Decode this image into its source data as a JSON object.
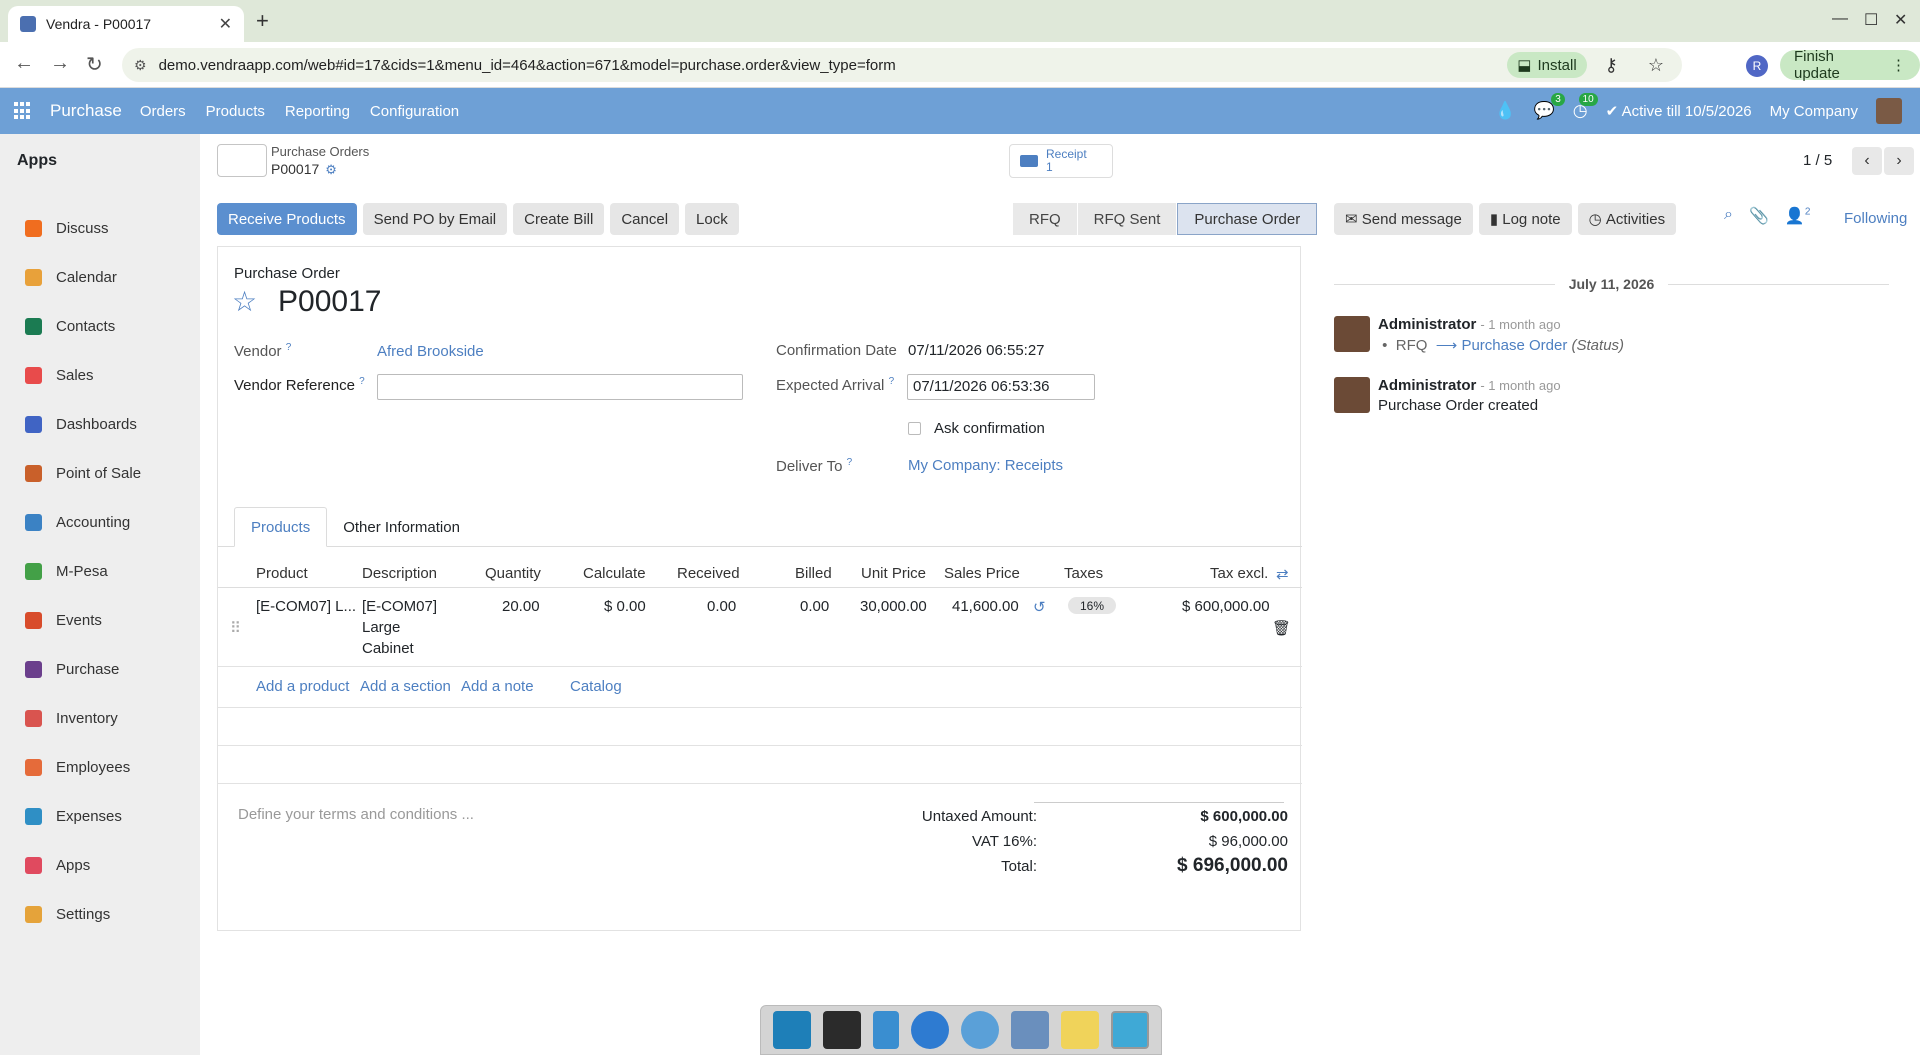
{
  "browser": {
    "tab_title": "Vendra - P00017",
    "url": "demo.vendraapp.com/web#id=17&cids=1&menu_id=464&action=671&model=purchase.order&view_type=form",
    "install_label": "Install",
    "profile_initial": "R",
    "finish_update_label": "Finish update"
  },
  "navbar": {
    "brand": "Purchase",
    "menus": [
      "Orders",
      "Products",
      "Reporting",
      "Configuration"
    ],
    "chat_badge": "3",
    "activity_badge": "10",
    "active_till": "Active till 10/5/2026",
    "company": "My Company"
  },
  "sidebar": {
    "title": "Apps",
    "items": [
      {
        "label": "Discuss",
        "color": "#f06d1f"
      },
      {
        "label": "Calendar",
        "color": "#e8a13a"
      },
      {
        "label": "Contacts",
        "color": "#1b7b52"
      },
      {
        "label": "Sales",
        "color": "#e84b4b"
      },
      {
        "label": "Dashboards",
        "color": "#4064c4"
      },
      {
        "label": "Point of Sale",
        "color": "#c9602a"
      },
      {
        "label": "Accounting",
        "color": "#3b82c4"
      },
      {
        "label": "M-Pesa",
        "color": "#43a047"
      },
      {
        "label": "Events",
        "color": "#d84c2b"
      },
      {
        "label": "Purchase",
        "color": "#6b3f8c"
      },
      {
        "label": "Inventory",
        "color": "#d9544f"
      },
      {
        "label": "Employees",
        "color": "#e56b3a"
      },
      {
        "label": "Expenses",
        "color": "#2f8fc5"
      },
      {
        "label": "Apps",
        "color": "#e04a5f"
      },
      {
        "label": "Settings",
        "color": "#e5a33a"
      }
    ]
  },
  "header": {
    "breadcrumb_parent": "Purchase Orders",
    "breadcrumb_current": "P00017",
    "receipt_label": "Receipt",
    "receipt_count": "1",
    "pager": "1 / 5"
  },
  "actions": {
    "receive": "Receive Products",
    "send_po": "Send PO by Email",
    "create_bill": "Create Bill",
    "cancel": "Cancel",
    "lock": "Lock"
  },
  "status": {
    "stages": [
      "RFQ",
      "RFQ Sent",
      "Purchase Order"
    ],
    "active_index": 2
  },
  "form": {
    "label": "Purchase Order",
    "name": "P00017",
    "vendor_label": "Vendor",
    "vendor": "Afred Brookside",
    "vendor_ref_label": "Vendor Reference",
    "vendor_ref": "",
    "confirmation_label": "Confirmation Date",
    "confirmation": "07/11/2026 06:55:27",
    "expected_label": "Expected Arrival",
    "expected": "07/11/2026 06:53:36",
    "ask_confirmation": "Ask confirmation",
    "deliver_label": "Deliver To",
    "deliver": "My Company: Receipts",
    "tabs": [
      "Products",
      "Other Information"
    ]
  },
  "table": {
    "headers": [
      "Product",
      "Description",
      "Quantity",
      "Calculate",
      "Received",
      "Billed",
      "Unit Price",
      "Sales Price",
      "Taxes",
      "Tax excl."
    ],
    "row": {
      "product": "[E-COM07] L...",
      "description": "[E-COM07]",
      "description_2": "Large",
      "description_3": "Cabinet",
      "quantity": "20.00",
      "calculate": "$ 0.00",
      "received": "0.00",
      "billed": "0.00",
      "unit_price": "30,000.00",
      "sales_price": "41,600.00",
      "tax": "16%",
      "subtotal": "$ 600,000.00"
    },
    "add_product": "Add a product",
    "add_section": "Add a section",
    "add_note": "Add a note",
    "catalog": "Catalog"
  },
  "totals": {
    "terms_placeholder": "Define your terms and conditions ...",
    "untaxed_label": "Untaxed Amount:",
    "untaxed": "$ 600,000.00",
    "vat_label": "VAT 16%:",
    "vat": "$ 96,000.00",
    "total_label": "Total:",
    "total": "$ 696,000.00"
  },
  "chatter": {
    "send_message": "Send message",
    "log_note": "Log note",
    "activities": "Activities",
    "followers_count": "2",
    "following": "Following",
    "date": "July 11, 2026",
    "messages": [
      {
        "author": "Administrator",
        "time": "- 1 month ago",
        "from": "RFQ",
        "to": "Purchase Order",
        "field": "(Status)"
      },
      {
        "author": "Administrator",
        "time": "- 1 month ago",
        "body": "Purchase Order created"
      }
    ]
  }
}
